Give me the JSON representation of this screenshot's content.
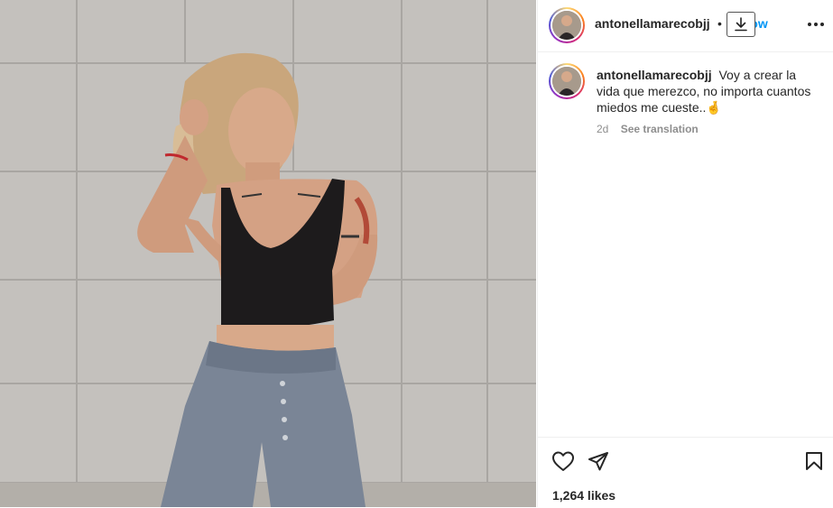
{
  "post": {
    "username": "antonellamarecobjj",
    "separator": "•",
    "follow_label": "Follow",
    "caption_text": "Voy a crear la vida que merezco, no importa cuantos miedos me cueste..",
    "caption_emoji": "🤞",
    "age": "2d",
    "see_translation": "See translation",
    "likes": "1,264 likes"
  },
  "icons": {
    "download": "download-icon",
    "more": "more-options-icon",
    "like": "heart-icon",
    "share": "share-icon",
    "save": "bookmark-icon"
  },
  "colors": {
    "follow_blue": "#0095f6",
    "text": "#262626",
    "muted": "#8e8e8e"
  }
}
